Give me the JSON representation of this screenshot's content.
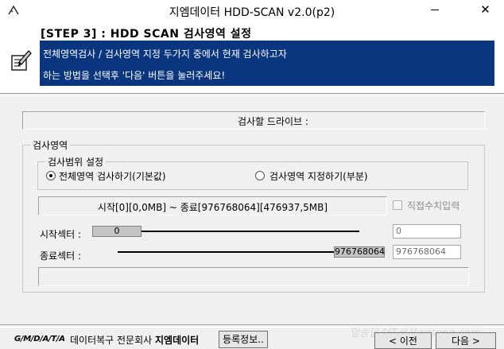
{
  "window": {
    "title": "지엠데이터 HDD-SCAN v2.0(p2)",
    "close_glyph": "✕"
  },
  "header": {
    "step_title": "[STEP 3] : HDD SCAN 검사영역 설정",
    "description_line1": "전체영역검사 / 검사영역 지정 두가지 중에서 현재 검사하고자",
    "description_line2": "하는 방법을 선택후 '다음' 버튼을 눌러주세요!",
    "accent_color": "#0a3680"
  },
  "drive": {
    "label": "검사할 드라이브 :"
  },
  "scan_area": {
    "group_label": "검사영역",
    "range_group_label": "검사범위 설정",
    "option_full": "전체영역 검사하기(기본값)",
    "option_partial": "검사영역 지정하기(부분)",
    "selected_option": "full",
    "range_summary": "시작[0][0,0MB] ~ 종료[976768064][476937,5MB]",
    "direct_input_label": "직접수치입력",
    "direct_input_checked": false
  },
  "sectors": {
    "start_label": "시작섹터 :",
    "start_value": "0",
    "start_input": "0",
    "end_label": "종료섹터 :",
    "end_value": "976768064",
    "end_input": "976768064"
  },
  "footer": {
    "logo_text": "G/M/D/A/T/A",
    "company_prefix": "데이터복구 전문회사 ",
    "company_name": "지엠데이터",
    "info_button": "등록정보..",
    "prev_button": "< 이전",
    "next_button": "다음 >",
    "watermark": "앞송달송IT세상 rdsong.com"
  }
}
